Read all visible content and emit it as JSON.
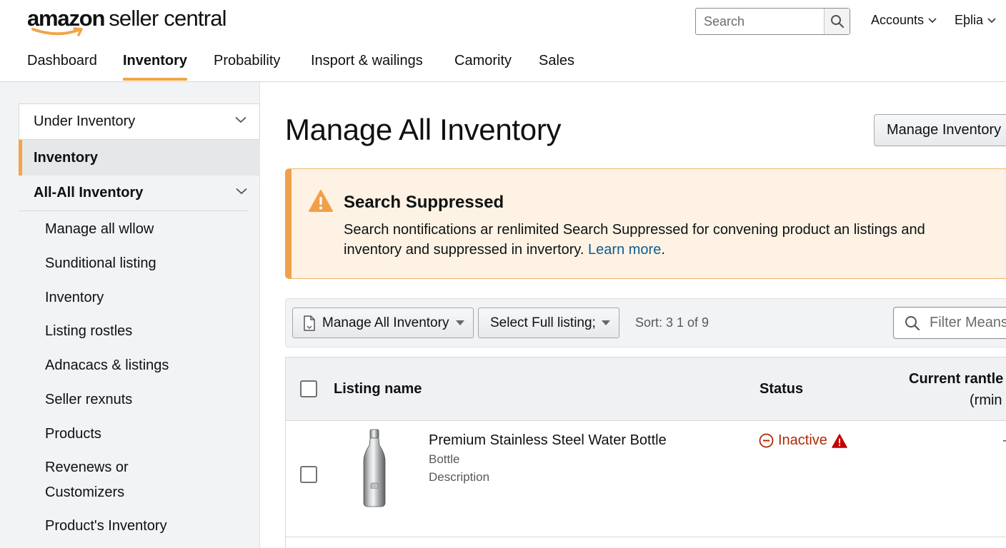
{
  "header": {
    "logo_brand": "amazon",
    "logo_rest": "seller central",
    "search_placeholder": "Search",
    "accounts_label": "Accounts",
    "help_label": "Eþlia"
  },
  "nav": {
    "tabs": [
      {
        "label": "Dashboard",
        "active": false
      },
      {
        "label": "Inventory",
        "active": true
      },
      {
        "label": "Probability",
        "active": false
      },
      {
        "label": "Insport & wailings",
        "active": false
      },
      {
        "label": "Camority",
        "active": false
      },
      {
        "label": "Sales",
        "active": false
      }
    ]
  },
  "sidebar": {
    "header": "Under Inventory",
    "active": "Inventory",
    "group": "All-All Inventory",
    "items": [
      "Manage all wllow",
      "Sunditional listing",
      "Inventory",
      "Listing rostles",
      "Adnacacs & listings",
      "Seller rexnuts",
      "Products",
      "Revenews or",
      "Customizers",
      "Product's Inventory"
    ]
  },
  "main": {
    "title": "Manage All Inventory",
    "manage_button": "Manage Inventory"
  },
  "alert": {
    "title": "Search Suppressed",
    "body_line1": "Search nontifications ar renlimited Search Suppressed for convening product an listings and",
    "body_line2": "inventory and suppressed in invertory.",
    "link": "Learn more",
    "after_link": "."
  },
  "toolbar": {
    "dropdown1": "Manage All Inventory",
    "dropdown2": "Select Full listing;",
    "sort_text": "Sort: 3  1 of 9",
    "filter_placeholder": "Filter Means"
  },
  "table": {
    "columns": {
      "name": "Listing name",
      "status": "Status",
      "price": "Current rantle",
      "price_sub": "(rmin"
    },
    "rows": [
      {
        "name": "Premium Stainless Steel Water Bottle",
        "sub1": "Bottle",
        "sub2": "Description",
        "status": "Inactive",
        "price": "-"
      }
    ]
  },
  "colors": {
    "accent_orange": "#f0a54a",
    "alert_bg": "#fdf2e4",
    "status_red": "#b12704",
    "link_blue": "#0f5d8c"
  }
}
